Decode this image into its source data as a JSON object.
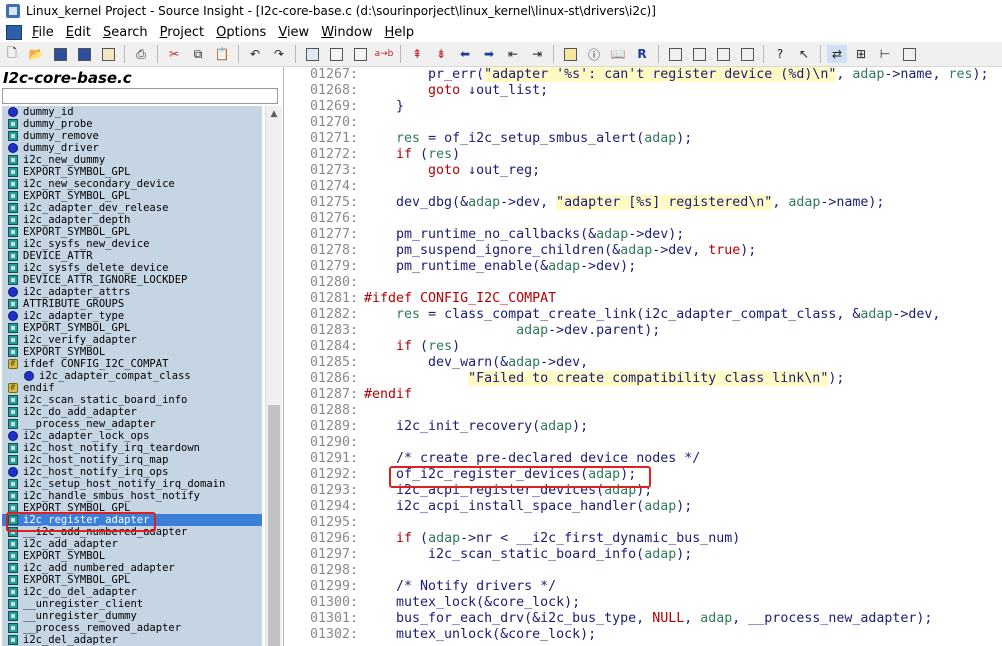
{
  "window": {
    "title": "Linux_kernel Project - Source Insight - [I2c-core-base.c (d:\\sourinporject\\linux_kernel\\linux-st\\drivers\\i2c)]"
  },
  "menu": [
    {
      "accel": "F",
      "rest": "ile"
    },
    {
      "accel": "E",
      "rest": "dit"
    },
    {
      "accel": "S",
      "rest": "earch"
    },
    {
      "accel": "P",
      "rest": "roject"
    },
    {
      "accel": "O",
      "rest": "ptions"
    },
    {
      "accel": "V",
      "rest": "iew"
    },
    {
      "accel": "W",
      "rest": "indow"
    },
    {
      "accel": "H",
      "rest": "elp"
    }
  ],
  "sidebar": {
    "file_title": "I2c-core-base.c",
    "search_value": "",
    "symbols": [
      {
        "name": "dummy_id",
        "kind": "func"
      },
      {
        "name": "dummy_probe",
        "kind": "macro"
      },
      {
        "name": "dummy_remove",
        "kind": "macro"
      },
      {
        "name": "dummy_driver",
        "kind": "func"
      },
      {
        "name": "i2c_new_dummy",
        "kind": "macro"
      },
      {
        "name": "EXPORT_SYMBOL_GPL",
        "kind": "macro"
      },
      {
        "name": "i2c_new_secondary_device",
        "kind": "macro"
      },
      {
        "name": "EXPORT_SYMBOL_GPL",
        "kind": "macro"
      },
      {
        "name": "i2c_adapter_dev_release",
        "kind": "macro"
      },
      {
        "name": "i2c_adapter_depth",
        "kind": "macro"
      },
      {
        "name": "EXPORT_SYMBOL_GPL",
        "kind": "macro"
      },
      {
        "name": "i2c_sysfs_new_device",
        "kind": "macro"
      },
      {
        "name": "DEVICE_ATTR",
        "kind": "macro"
      },
      {
        "name": "i2c_sysfs_delete_device",
        "kind": "macro"
      },
      {
        "name": "DEVICE_ATTR_IGNORE_LOCKDEP",
        "kind": "macro"
      },
      {
        "name": "i2c_adapter_attrs",
        "kind": "func"
      },
      {
        "name": "ATTRIBUTE_GROUPS",
        "kind": "macro"
      },
      {
        "name": "i2c_adapter_type",
        "kind": "func"
      },
      {
        "name": "EXPORT_SYMBOL_GPL",
        "kind": "macro"
      },
      {
        "name": "i2c_verify_adapter",
        "kind": "macro"
      },
      {
        "name": "EXPORT_SYMBOL",
        "kind": "macro"
      },
      {
        "name": "ifdef CONFIG_I2C_COMPAT",
        "kind": "cond"
      },
      {
        "name": "i2c_adapter_compat_class",
        "kind": "func",
        "indent": true
      },
      {
        "name": "endif",
        "kind": "cond"
      },
      {
        "name": "i2c_scan_static_board_info",
        "kind": "macro"
      },
      {
        "name": "i2c_do_add_adapter",
        "kind": "macro"
      },
      {
        "name": "__process_new_adapter",
        "kind": "macro"
      },
      {
        "name": "i2c_adapter_lock_ops",
        "kind": "func"
      },
      {
        "name": "i2c_host_notify_irq_teardown",
        "kind": "macro"
      },
      {
        "name": "i2c_host_notify_irq_map",
        "kind": "macro"
      },
      {
        "name": "i2c_host_notify_irq_ops",
        "kind": "func"
      },
      {
        "name": "i2c_setup_host_notify_irq_domain",
        "kind": "macro"
      },
      {
        "name": "i2c_handle_smbus_host_notify",
        "kind": "macro"
      },
      {
        "name": "EXPORT_SYMBOL_GPL",
        "kind": "macro"
      },
      {
        "name": "i2c_register_adapter",
        "kind": "macro",
        "selected": true
      },
      {
        "name": "__i2c_add_numbered_adapter",
        "kind": "macro"
      },
      {
        "name": "i2c_add_adapter",
        "kind": "macro"
      },
      {
        "name": "EXPORT_SYMBOL",
        "kind": "macro"
      },
      {
        "name": "i2c_add_numbered_adapter",
        "kind": "macro"
      },
      {
        "name": "EXPORT_SYMBOL_GPL",
        "kind": "macro"
      },
      {
        "name": "i2c_do_del_adapter",
        "kind": "macro"
      },
      {
        "name": "__unregister_client",
        "kind": "macro"
      },
      {
        "name": "__unregister_dummy",
        "kind": "macro"
      },
      {
        "name": "__process_removed_adapter",
        "kind": "macro"
      },
      {
        "name": "i2c_del_adapter",
        "kind": "macro"
      }
    ]
  },
  "editor": {
    "lines": [
      {
        "n": "01267:",
        "parts": [
          [
            "t",
            "        "
          ],
          [
            "c",
            "pr_err"
          ],
          [
            "t",
            "("
          ],
          [
            "s",
            "\"adapter '%s': can't register device (%d)\\n\""
          ],
          [
            "t",
            ", "
          ],
          [
            "v",
            "adap"
          ],
          [
            "t",
            "->name, "
          ],
          [
            "v",
            "res"
          ],
          [
            "t",
            ");"
          ]
        ]
      },
      {
        "n": "01268:",
        "parts": [
          [
            "t",
            "        "
          ],
          [
            "k",
            "goto"
          ],
          [
            "t",
            " ↓out_list;"
          ]
        ]
      },
      {
        "n": "01269:",
        "parts": [
          [
            "t",
            "    }"
          ]
        ]
      },
      {
        "n": "01270:",
        "parts": []
      },
      {
        "n": "01271:",
        "parts": [
          [
            "t",
            "    "
          ],
          [
            "v",
            "res"
          ],
          [
            "t",
            " = of_i2c_setup_smbus_alert("
          ],
          [
            "v",
            "adap"
          ],
          [
            "t",
            ");"
          ]
        ]
      },
      {
        "n": "01272:",
        "parts": [
          [
            "t",
            "    "
          ],
          [
            "k",
            "if"
          ],
          [
            "t",
            " ("
          ],
          [
            "v",
            "res"
          ],
          [
            "t",
            ")"
          ]
        ]
      },
      {
        "n": "01273:",
        "parts": [
          [
            "t",
            "        "
          ],
          [
            "k",
            "goto"
          ],
          [
            "t",
            " ↓out_reg;"
          ]
        ]
      },
      {
        "n": "01274:",
        "parts": []
      },
      {
        "n": "01275:",
        "parts": [
          [
            "t",
            "    dev_dbg(&"
          ],
          [
            "v",
            "adap"
          ],
          [
            "t",
            "->dev, "
          ],
          [
            "s",
            "\"adapter [%s] registered\\n\""
          ],
          [
            "t",
            ", "
          ],
          [
            "v",
            "adap"
          ],
          [
            "t",
            "->name);"
          ]
        ]
      },
      {
        "n": "01276:",
        "parts": []
      },
      {
        "n": "01277:",
        "parts": [
          [
            "t",
            "    pm_runtime_no_callbacks(&"
          ],
          [
            "v",
            "adap"
          ],
          [
            "t",
            "->dev);"
          ]
        ]
      },
      {
        "n": "01278:",
        "parts": [
          [
            "t",
            "    pm_suspend_ignore_children(&"
          ],
          [
            "v",
            "adap"
          ],
          [
            "t",
            "->dev, "
          ],
          [
            "k",
            "true"
          ],
          [
            "t",
            ");"
          ]
        ]
      },
      {
        "n": "01279:",
        "parts": [
          [
            "t",
            "    pm_runtime_enable(&"
          ],
          [
            "v",
            "adap"
          ],
          [
            "t",
            "->dev);"
          ]
        ]
      },
      {
        "n": "01280:",
        "parts": []
      },
      {
        "n": "01281:",
        "parts": [
          [
            "p",
            "#ifdef CONFIG_I2C_COMPAT"
          ]
        ]
      },
      {
        "n": "01282:",
        "parts": [
          [
            "t",
            "    "
          ],
          [
            "v",
            "res"
          ],
          [
            "t",
            " = class_compat_create_link(i2c_adapter_compat_class, &"
          ],
          [
            "v",
            "adap"
          ],
          [
            "t",
            "->dev,"
          ]
        ]
      },
      {
        "n": "01283:",
        "parts": [
          [
            "t",
            "                   "
          ],
          [
            "v",
            "adap"
          ],
          [
            "t",
            "->dev.parent);"
          ]
        ]
      },
      {
        "n": "01284:",
        "parts": [
          [
            "t",
            "    "
          ],
          [
            "k",
            "if"
          ],
          [
            "t",
            " ("
          ],
          [
            "v",
            "res"
          ],
          [
            "t",
            ")"
          ]
        ]
      },
      {
        "n": "01285:",
        "parts": [
          [
            "t",
            "        dev_warn(&"
          ],
          [
            "v",
            "adap"
          ],
          [
            "t",
            "->dev,"
          ]
        ]
      },
      {
        "n": "01286:",
        "parts": [
          [
            "t",
            "             "
          ],
          [
            "s",
            "\"Failed to create compatibility class link\\n\""
          ],
          [
            "t",
            ");"
          ]
        ]
      },
      {
        "n": "01287:",
        "parts": [
          [
            "p",
            "#endif"
          ]
        ]
      },
      {
        "n": "01288:",
        "parts": []
      },
      {
        "n": "01289:",
        "parts": [
          [
            "t",
            "    i2c_init_recovery("
          ],
          [
            "v",
            "adap"
          ],
          [
            "t",
            ");"
          ]
        ]
      },
      {
        "n": "01290:",
        "parts": []
      },
      {
        "n": "01291:",
        "parts": [
          [
            "t",
            "    "
          ],
          [
            "m",
            "/* create pre-declared device nodes */"
          ]
        ]
      },
      {
        "n": "01292:",
        "parts": [
          [
            "t",
            "    of_i2c_register_devices("
          ],
          [
            "v",
            "adap"
          ],
          [
            "t",
            ");"
          ]
        ]
      },
      {
        "n": "01293:",
        "parts": [
          [
            "t",
            "    i2c_acpi_register_devices("
          ],
          [
            "v",
            "adap"
          ],
          [
            "t",
            ");"
          ]
        ]
      },
      {
        "n": "01294:",
        "parts": [
          [
            "t",
            "    i2c_acpi_install_space_handler("
          ],
          [
            "v",
            "adap"
          ],
          [
            "t",
            ");"
          ]
        ]
      },
      {
        "n": "01295:",
        "parts": []
      },
      {
        "n": "01296:",
        "parts": [
          [
            "t",
            "    "
          ],
          [
            "k",
            "if"
          ],
          [
            "t",
            " ("
          ],
          [
            "v",
            "adap"
          ],
          [
            "t",
            "->nr < __i2c_first_dynamic_bus_num)"
          ]
        ]
      },
      {
        "n": "01297:",
        "parts": [
          [
            "t",
            "        i2c_scan_static_board_info("
          ],
          [
            "v",
            "adap"
          ],
          [
            "t",
            ");"
          ]
        ]
      },
      {
        "n": "01298:",
        "parts": []
      },
      {
        "n": "01299:",
        "parts": [
          [
            "t",
            "    "
          ],
          [
            "m",
            "/* Notify drivers */"
          ]
        ]
      },
      {
        "n": "01300:",
        "parts": [
          [
            "t",
            "    mutex_lock(&core_lock);"
          ]
        ]
      },
      {
        "n": "01301:",
        "parts": [
          [
            "t",
            "    bus_for_each_drv(&i2c_bus_type, "
          ],
          [
            "k",
            "NULL"
          ],
          [
            "t",
            ", "
          ],
          [
            "v",
            "adap"
          ],
          [
            "t",
            ", __process_new_adapter);"
          ]
        ]
      },
      {
        "n": "01302:",
        "parts": [
          [
            "t",
            "    mutex_unlock(&core_lock);"
          ]
        ]
      }
    ]
  }
}
